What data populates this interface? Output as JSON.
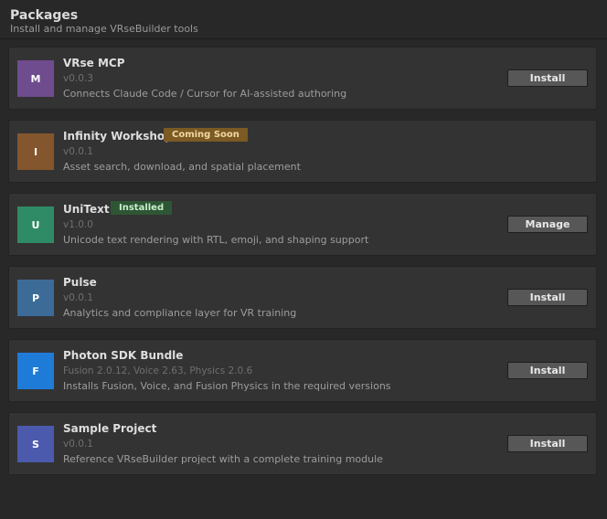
{
  "header": {
    "title": "Packages",
    "subtitle": "Install and manage VRseBuilder tools"
  },
  "packages": [
    {
      "icon_letter": "M",
      "icon_color": "#6e4c8e",
      "name": "VRse MCP",
      "badge": null,
      "version": "v0.0.3",
      "description": "Connects Claude Code / Cursor for AI-assisted authoring",
      "action": "Install"
    },
    {
      "icon_letter": "I",
      "icon_color": "#83562e",
      "name": "Infinity Workshop",
      "badge": {
        "label": "Coming Soon",
        "type": "soon"
      },
      "version": "v0.0.1",
      "description": "Asset search, download, and spatial placement",
      "action": null
    },
    {
      "icon_letter": "U",
      "icon_color": "#2e8b65",
      "name": "UniText",
      "badge": {
        "label": "Installed",
        "type": "installed"
      },
      "version": "v1.0.0",
      "description": "Unicode text rendering with RTL, emoji, and shaping support",
      "action": "Manage"
    },
    {
      "icon_letter": "P",
      "icon_color": "#3b6b96",
      "name": "Pulse",
      "badge": null,
      "version": "v0.0.1",
      "description": "Analytics and compliance layer for VR training",
      "action": "Install"
    },
    {
      "icon_letter": "F",
      "icon_color": "#1f7bd8",
      "name": "Photon SDK Bundle",
      "badge": null,
      "version": "Fusion 2.0.12, Voice 2.63, Physics 2.0.6",
      "description": "Installs Fusion, Voice, and Fusion Physics in the required versions",
      "action": "Install"
    },
    {
      "icon_letter": "S",
      "icon_color": "#4b5aad",
      "name": "Sample Project",
      "badge": null,
      "version": "v0.0.1",
      "description": "Reference VRseBuilder project with a complete training module",
      "action": "Install"
    }
  ]
}
